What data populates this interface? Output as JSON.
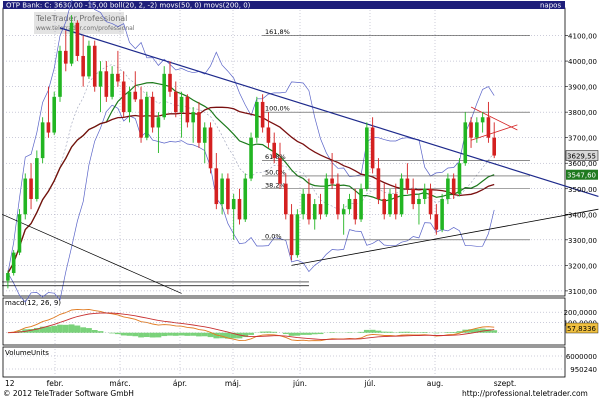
{
  "header": {
    "title": "OTP Bank: C: 3630,00 -15,00 boll(20, 2, -2) movs(50, 0) movs(200, 0)",
    "period": "napos"
  },
  "colors": {
    "frame": "#000000",
    "grid": "#9a9ab4",
    "up": "#22b522",
    "down": "#d42020",
    "trend": "#1e2a8c",
    "movs50": "#1c7a1c",
    "movs200": "#7a1010",
    "bollinger": "#5a64c8",
    "macd_line": "#e07a20",
    "macd_signal": "#c83232",
    "macd_hist": "#7ad27a",
    "header_bg": "#1e1e7a",
    "header_fg": "#ffffff",
    "last_bg": "#1e7a1e"
  },
  "chart_data": [
    {
      "type": "candlestick",
      "title": "OTP Bank",
      "ylim": [
        3080,
        4200
      ],
      "grid": true,
      "ytick_labels": [
        "4100,00",
        "4000,00",
        "3900,00",
        "3800,00",
        "3700,00",
        "3600,00",
        "3500,00",
        "3400,00",
        "3300,00",
        "3200,00",
        "3100,00"
      ],
      "ytick_values": [
        4100,
        4000,
        3900,
        3800,
        3700,
        3600,
        3500,
        3400,
        3300,
        3200,
        3100
      ],
      "xtick_labels": [
        "12",
        "febr.",
        "márc.",
        "ápr.",
        "máj.",
        "jún.",
        "júl.",
        "aug.",
        "szept."
      ],
      "last_price": "3629,55",
      "ma_value_label": "3547,60",
      "fibonacci": [
        {
          "label": "161,8%",
          "value": 4100
        },
        {
          "label": "100,0%",
          "value": 3800
        },
        {
          "label": "61,8%",
          "value": 3610
        },
        {
          "label": "50,0%",
          "value": 3550
        },
        {
          "label": "38,2%",
          "value": 3500
        },
        {
          "label": "0,0%",
          "value": 3300
        }
      ],
      "ohlc": [
        [
          3140,
          3180,
          3110,
          3170
        ],
        [
          3170,
          3260,
          3160,
          3250
        ],
        [
          3250,
          3420,
          3240,
          3400
        ],
        [
          3400,
          3560,
          3380,
          3540
        ],
        [
          3540,
          3600,
          3420,
          3460
        ],
        [
          3460,
          3650,
          3450,
          3620
        ],
        [
          3620,
          3780,
          3600,
          3760
        ],
        [
          3760,
          3900,
          3700,
          3720
        ],
        [
          3720,
          3880,
          3710,
          3860
        ],
        [
          3860,
          4060,
          3840,
          4040
        ],
        [
          4040,
          4120,
          3960,
          3990
        ],
        [
          3990,
          4180,
          3980,
          4150
        ],
        [
          4150,
          4160,
          4000,
          4020
        ],
        [
          4020,
          4100,
          3900,
          3940
        ],
        [
          3940,
          4080,
          3930,
          4060
        ],
        [
          4060,
          4080,
          3880,
          3900
        ],
        [
          3900,
          4000,
          3800,
          3960
        ],
        [
          3960,
          4000,
          3840,
          3860
        ],
        [
          3860,
          3980,
          3850,
          3950
        ],
        [
          3950,
          4040,
          3900,
          3920
        ],
        [
          3920,
          3960,
          3780,
          3800
        ],
        [
          3800,
          3900,
          3760,
          3880
        ],
        [
          3880,
          3960,
          3840,
          3850
        ],
        [
          3850,
          3900,
          3680,
          3700
        ],
        [
          3700,
          3880,
          3690,
          3860
        ],
        [
          3860,
          3880,
          3720,
          3740
        ],
        [
          3740,
          3800,
          3640,
          3780
        ],
        [
          3780,
          3980,
          3770,
          3950
        ],
        [
          3950,
          4000,
          3860,
          3880
        ],
        [
          3880,
          3920,
          3780,
          3800
        ],
        [
          3800,
          3880,
          3700,
          3860
        ],
        [
          3860,
          3870,
          3740,
          3760
        ],
        [
          3760,
          3820,
          3680,
          3800
        ],
        [
          3800,
          3840,
          3660,
          3680
        ],
        [
          3680,
          3760,
          3600,
          3740
        ],
        [
          3740,
          3760,
          3560,
          3580
        ],
        [
          3580,
          3640,
          3420,
          3440
        ],
        [
          3440,
          3560,
          3400,
          3540
        ],
        [
          3540,
          3560,
          3400,
          3420
        ],
        [
          3420,
          3480,
          3300,
          3460
        ],
        [
          3460,
          3500,
          3360,
          3380
        ],
        [
          3380,
          3560,
          3370,
          3540
        ],
        [
          3540,
          3720,
          3530,
          3700
        ],
        [
          3700,
          3860,
          3680,
          3840
        ],
        [
          3840,
          3870,
          3720,
          3740
        ],
        [
          3740,
          3800,
          3660,
          3680
        ],
        [
          3680,
          3720,
          3600,
          3620
        ],
        [
          3620,
          3680,
          3500,
          3520
        ],
        [
          3520,
          3560,
          3380,
          3400
        ],
        [
          3400,
          3440,
          3220,
          3240
        ],
        [
          3240,
          3420,
          3230,
          3400
        ],
        [
          3400,
          3500,
          3380,
          3480
        ],
        [
          3480,
          3540,
          3360,
          3380
        ],
        [
          3380,
          3460,
          3340,
          3440
        ],
        [
          3440,
          3480,
          3380,
          3400
        ],
        [
          3400,
          3560,
          3390,
          3540
        ],
        [
          3540,
          3640,
          3500,
          3520
        ],
        [
          3520,
          3560,
          3380,
          3400
        ],
        [
          3400,
          3440,
          3320,
          3420
        ],
        [
          3420,
          3480,
          3400,
          3460
        ],
        [
          3460,
          3500,
          3360,
          3380
        ],
        [
          3380,
          3520,
          3370,
          3500
        ],
        [
          3500,
          3760,
          3490,
          3740
        ],
        [
          3740,
          3780,
          3560,
          3580
        ],
        [
          3580,
          3620,
          3440,
          3460
        ],
        [
          3460,
          3520,
          3380,
          3400
        ],
        [
          3400,
          3500,
          3390,
          3480
        ],
        [
          3480,
          3520,
          3380,
          3400
        ],
        [
          3400,
          3560,
          3390,
          3540
        ],
        [
          3540,
          3600,
          3480,
          3500
        ],
        [
          3500,
          3540,
          3420,
          3440
        ],
        [
          3440,
          3480,
          3360,
          3460
        ],
        [
          3460,
          3520,
          3440,
          3500
        ],
        [
          3500,
          3520,
          3380,
          3400
        ],
        [
          3400,
          3440,
          3320,
          3340
        ],
        [
          3340,
          3480,
          3330,
          3460
        ],
        [
          3460,
          3560,
          3440,
          3540
        ],
        [
          3540,
          3560,
          3460,
          3480
        ],
        [
          3480,
          3620,
          3470,
          3600
        ],
        [
          3600,
          3800,
          3590,
          3760
        ],
        [
          3760,
          3780,
          3660,
          3700
        ],
        [
          3700,
          3780,
          3680,
          3760
        ],
        [
          3760,
          3800,
          3720,
          3780
        ],
        [
          3780,
          3840,
          3680,
          3700
        ],
        [
          3700,
          3760,
          3620,
          3630
        ]
      ]
    },
    {
      "type": "line",
      "title": "macd(12, 26, 9)",
      "ylim": [
        -100000,
        260000
      ],
      "ytick_labels": [
        "200,0000",
        "100,0000"
      ],
      "ytick_values": [
        200000,
        100000
      ],
      "last_value_label": "57,8336"
    },
    {
      "type": "bar",
      "title": "VolumeUnits",
      "ytick_labels": [
        "6000000",
        "950240"
      ],
      "ytick_values": [
        6000000,
        950240
      ]
    }
  ],
  "footer": {
    "copyright": "© 2012 TeleTrader Software GmbH",
    "url": "http://professional.teletrader.com"
  },
  "watermark": {
    "line1": "TeleTrader Professional",
    "line2": "www.teletrader.com/professional"
  }
}
